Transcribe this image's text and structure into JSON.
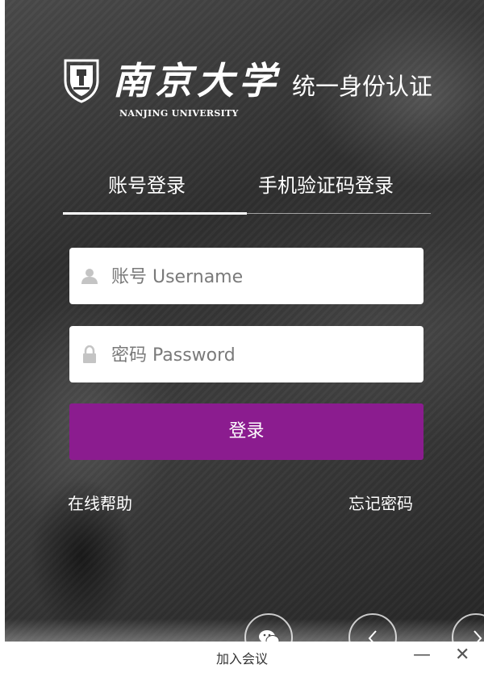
{
  "logo": {
    "chinese_name": "南京大学",
    "english_name": "NANJING UNIVERSITY",
    "title": "统一身份认证"
  },
  "tabs": [
    {
      "label": "账号登录",
      "active": true
    },
    {
      "label": "手机验证码登录",
      "active": false
    }
  ],
  "form": {
    "username": {
      "placeholder": "账号 Username",
      "value": "",
      "icon": "user-icon"
    },
    "password": {
      "placeholder": "密码 Password",
      "value": "",
      "icon": "lock-icon"
    },
    "login_label": "登录"
  },
  "links": {
    "help": "在线帮助",
    "forgot": "忘记密码"
  },
  "bottom_buttons": [
    "wechat-icon",
    "prev-arrow-icon",
    "next-arrow-icon"
  ],
  "window": {
    "title": "加入会议",
    "minimize": "—",
    "close": "✕"
  },
  "colors": {
    "login_button": "#8b1c8f",
    "text_on_dark": "#ffffff"
  }
}
